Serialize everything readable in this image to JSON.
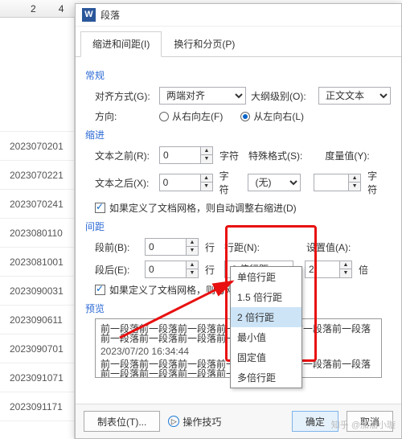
{
  "ruler": {
    "t1": "2",
    "t2": "4"
  },
  "leftcol": [
    "2023070201",
    "2023070221",
    "2023070241",
    "2023080110",
    "2023081001",
    "2023090031",
    "2023090611",
    "2023090701",
    "2023091071",
    "2023091171"
  ],
  "dialog": {
    "title": "段落",
    "tabs": [
      "缩进和间距(I)",
      "换行和分页(P)"
    ],
    "sect": {
      "general": "常规",
      "indent": "缩进",
      "spacing": "间距",
      "preview": "预览"
    },
    "general": {
      "align_lbl": "对齐方式(G):",
      "align_val": "两端对齐",
      "outline_lbl": "大纲级别(O):",
      "outline_val": "正文文本",
      "dir_lbl": "方向:",
      "dir_rtl": "从右向左(F)",
      "dir_ltr": "从左向右(L)"
    },
    "indent": {
      "before_lbl": "文本之前(R):",
      "before_val": "0",
      "before_unit": "字符",
      "special_lbl": "特殊格式(S):",
      "special_val": "(无)",
      "by_lbl": "度量值(Y):",
      "by_unit": "字符",
      "after_lbl": "文本之后(X):",
      "after_val": "0",
      "after_unit": "字符",
      "auto_lbl": "如果定义了文档网格，则自动调整右缩进(D)"
    },
    "spacing": {
      "before_lbl": "段前(B):",
      "before_val": "0",
      "before_unit": "行",
      "after_lbl": "段后(E):",
      "after_val": "0",
      "after_unit": "行",
      "line_lbl": "行距(N):",
      "line_val": "2 倍行距",
      "at_lbl": "设置值(A):",
      "at_val": "2",
      "at_unit": "倍",
      "grid_lbl": "如果定义了文档网格，则与网格对齐"
    },
    "line_options": [
      "单倍行距",
      "1.5 倍行距",
      "2 倍行距",
      "最小值",
      "固定值",
      "多倍行距"
    ],
    "preview_text": "前一段落前一段落前一段落前一段落前一段落前一段落前一段落前一段落前一段落前一段落前一段落前一段落",
    "preview_date": "2023/07/20 16:34:44",
    "footer": {
      "tabs": "制表位(T)...",
      "tips": "操作技巧",
      "ok": "确定",
      "cancel": "取消"
    }
  },
  "watermark": "知乎 @加油小璇"
}
